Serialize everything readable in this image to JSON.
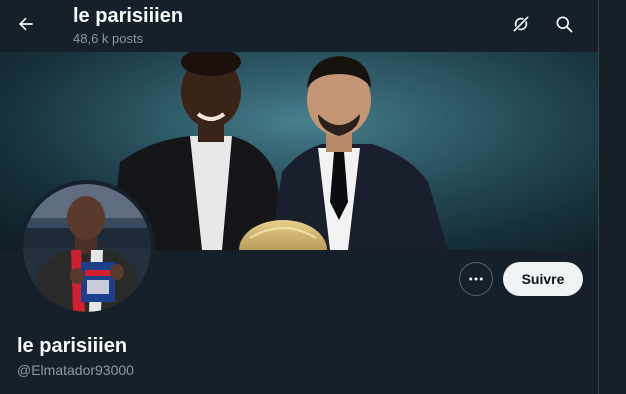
{
  "header": {
    "title": "le parisiiien",
    "subtitle": "48,6 k posts"
  },
  "icons": {
    "back": "arrow-left-icon",
    "grok": "grok-icon",
    "search": "search-icon",
    "more": "more-horizontal-icon"
  },
  "profile": {
    "display_name": "le parisiiien",
    "handle": "@Elmatador93000",
    "follow_label": "Suivre"
  },
  "colors": {
    "background": "#15202b",
    "text_primary": "#f7f9f9",
    "text_secondary": "#8b98a5",
    "button_light": "#eff3f4",
    "border": "#536471"
  }
}
